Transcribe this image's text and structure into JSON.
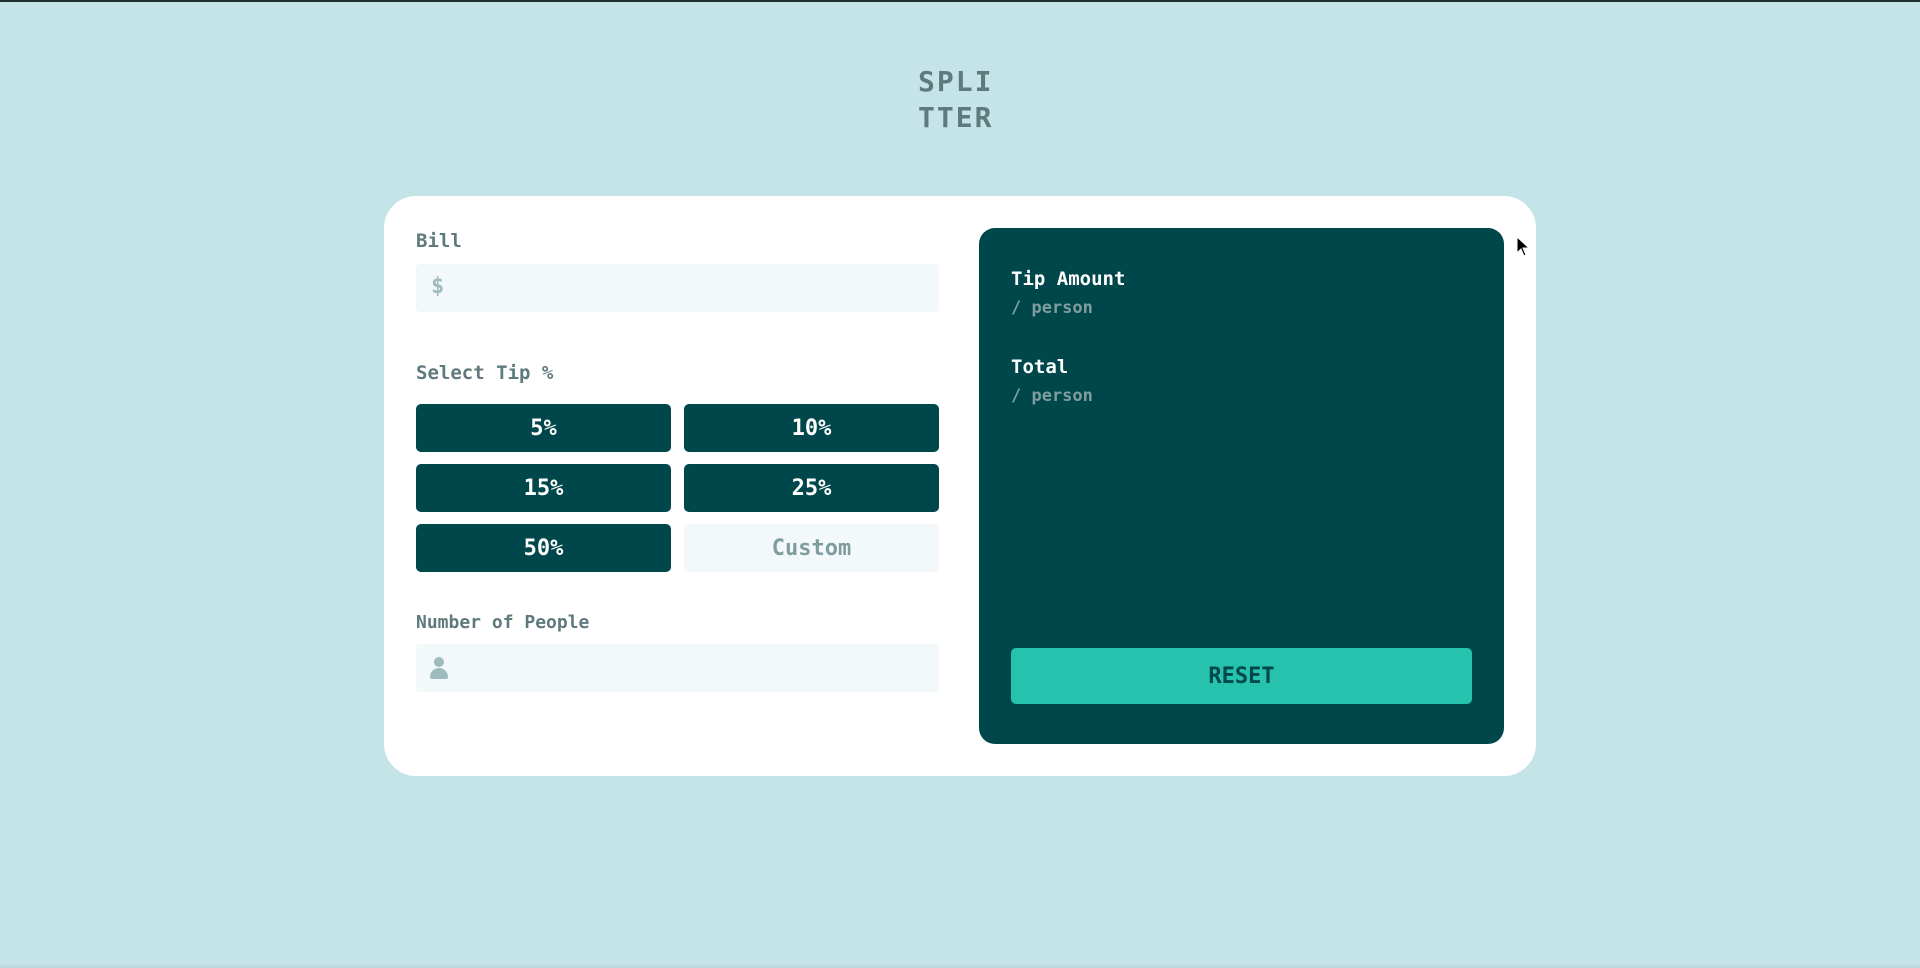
{
  "logo": {
    "line1": "SPLI",
    "line2": "TTER"
  },
  "bill": {
    "label": "Bill",
    "prefix": "$",
    "value": ""
  },
  "tip": {
    "label": "Select Tip %",
    "options": [
      "5%",
      "10%",
      "15%",
      "25%",
      "50%"
    ],
    "custom_placeholder": "Custom"
  },
  "people": {
    "label": "Number of People",
    "value": ""
  },
  "results": {
    "tip_amount_label": "Tip Amount",
    "tip_amount_sub": "/ person",
    "total_label": "Total",
    "total_sub": "/ person",
    "reset_label": "RESET"
  },
  "colors": {
    "background": "#c5e4e7",
    "dark_cyan": "#00474b",
    "accent": "#26c2ad",
    "label_grey": "#5e7a7d",
    "input_bg": "#f3f9fa"
  },
  "icons": {
    "bill": "dollar-icon",
    "people": "person-icon"
  }
}
